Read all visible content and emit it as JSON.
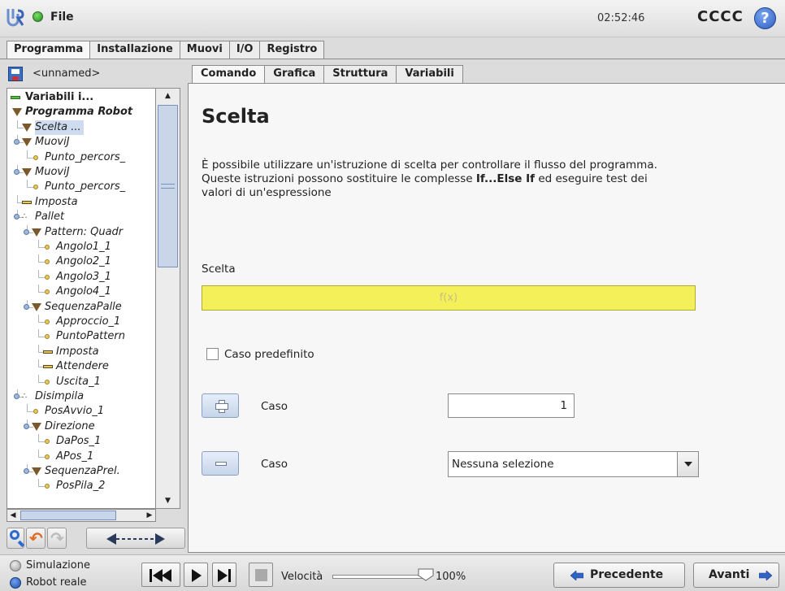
{
  "topbar": {
    "file_label": "File",
    "clock": "02:52:46",
    "robot_name": "CCCC",
    "help_glyph": "?"
  },
  "main_tabs": [
    {
      "label": "Programma",
      "active": true
    },
    {
      "label": "Installazione",
      "active": false
    },
    {
      "label": "Muovi",
      "active": false
    },
    {
      "label": "I/O",
      "active": false
    },
    {
      "label": "Registro",
      "active": false
    }
  ],
  "program_name": "<unnamed>",
  "tree": [
    {
      "label": "Variabili i...",
      "indent": 0,
      "icon": "bar-green",
      "style": "bold"
    },
    {
      "label": "Programma Robot",
      "indent": 0,
      "icon": "triangle",
      "style": "bold-italic"
    },
    {
      "label": "Scelta ...",
      "indent": 1,
      "icon": "triangle",
      "style": "selected"
    },
    {
      "label": "MuoviJ",
      "indent": 1,
      "icon": "triangle",
      "style": "italic",
      "expander": true
    },
    {
      "label": "Punto_percors_",
      "indent": 2,
      "icon": "point",
      "style": "italic"
    },
    {
      "label": "MuoviJ",
      "indent": 1,
      "icon": "triangle",
      "style": "italic",
      "expander": true
    },
    {
      "label": "Punto_percors_",
      "indent": 2,
      "icon": "point",
      "style": "italic"
    },
    {
      "label": "Imposta",
      "indent": 1,
      "icon": "bar",
      "style": "italic"
    },
    {
      "label": "Pallet",
      "indent": 1,
      "icon": "dots",
      "style": "italic",
      "expander": true
    },
    {
      "label": "Pattern: Quadr",
      "indent": 2,
      "icon": "triangle",
      "style": "italic",
      "expander": true
    },
    {
      "label": "Angolo1_1",
      "indent": 3,
      "icon": "point",
      "style": "italic"
    },
    {
      "label": "Angolo2_1",
      "indent": 3,
      "icon": "point",
      "style": "italic"
    },
    {
      "label": "Angolo3_1",
      "indent": 3,
      "icon": "point",
      "style": "italic"
    },
    {
      "label": "Angolo4_1",
      "indent": 3,
      "icon": "point",
      "style": "italic"
    },
    {
      "label": "SequenzaPalle",
      "indent": 2,
      "icon": "triangle",
      "style": "italic",
      "expander": true
    },
    {
      "label": "Approccio_1",
      "indent": 3,
      "icon": "point",
      "style": "italic"
    },
    {
      "label": "PuntoPattern",
      "indent": 3,
      "icon": "point",
      "style": "italic"
    },
    {
      "label": "Imposta",
      "indent": 3,
      "icon": "bar",
      "style": "italic"
    },
    {
      "label": "Attendere",
      "indent": 3,
      "icon": "bar",
      "style": "italic"
    },
    {
      "label": "Uscita_1",
      "indent": 3,
      "icon": "point",
      "style": "italic"
    },
    {
      "label": "Disimpila",
      "indent": 1,
      "icon": "dots",
      "style": "italic",
      "expander": true
    },
    {
      "label": "PosAvvio_1",
      "indent": 2,
      "icon": "point",
      "style": "italic"
    },
    {
      "label": "Direzione",
      "indent": 2,
      "icon": "triangle",
      "style": "italic",
      "expander": true
    },
    {
      "label": "DaPos_1",
      "indent": 3,
      "icon": "point",
      "style": "italic"
    },
    {
      "label": "APos_1",
      "indent": 3,
      "icon": "point",
      "style": "italic"
    },
    {
      "label": "SequenzaPrel.",
      "indent": 2,
      "icon": "triangle",
      "style": "italic",
      "expander": true
    },
    {
      "label": "PosPila_2",
      "indent": 3,
      "icon": "point",
      "style": "italic"
    }
  ],
  "sub_tabs": [
    {
      "label": "Comando",
      "active": true
    },
    {
      "label": "Grafica",
      "active": false
    },
    {
      "label": "Struttura",
      "active": false
    },
    {
      "label": "Variabili",
      "active": false
    }
  ],
  "content": {
    "title": "Scelta",
    "desc_part1": "È possibile utilizzare un'istruzione di scelta per controllare il flusso del programma. Queste istruzioni possono sostituire le complesse ",
    "desc_bold": "If...Else If",
    "desc_part2": " ed eseguire test dei valori di un'espressione",
    "field_label": "Scelta",
    "expression_placeholder": "f(x)",
    "default_case_label": "Caso predefinito",
    "default_case_checked": false,
    "add_case_label": "Caso",
    "add_case_value": "1",
    "remove_case_label": "Caso",
    "remove_case_selection": "Nessuna selezione",
    "expression_color": "#f4f05a"
  },
  "bottombar": {
    "simulation_label": "Simulazione",
    "real_robot_label": "Robot reale",
    "mode_selected": "Robot reale",
    "speed_label": "Velocità",
    "speed_value": "100%",
    "speed_fraction": 1.0,
    "prev_label": "Precedente",
    "next_label": "Avanti"
  }
}
